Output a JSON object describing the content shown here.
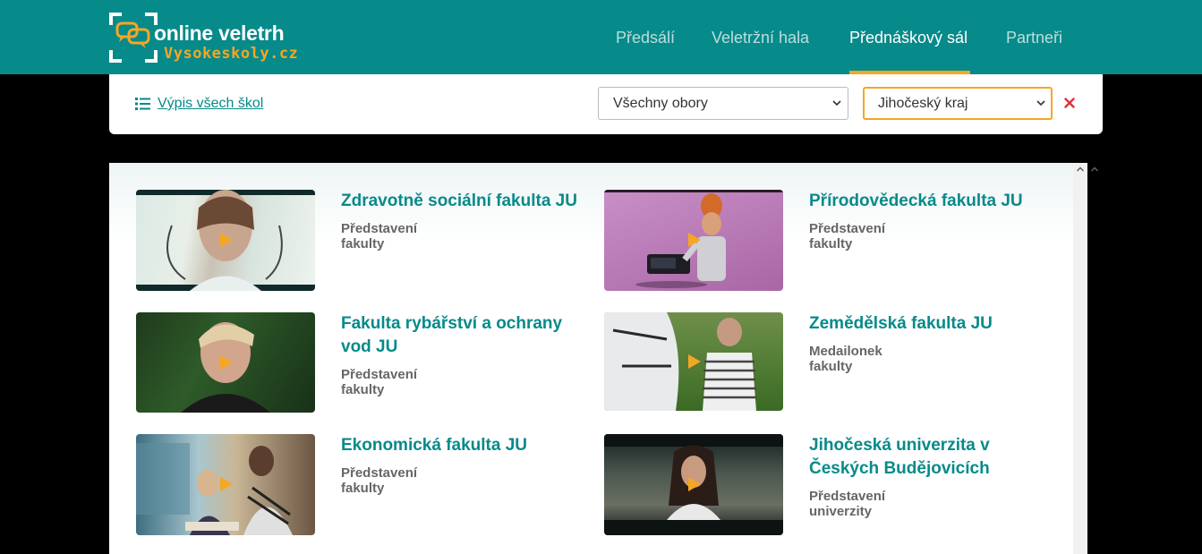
{
  "logo": {
    "line1": "online veletrh",
    "line2": "Vysokeskoly.cz"
  },
  "nav": [
    {
      "label": "Předsálí"
    },
    {
      "label": "Veletržní hala"
    },
    {
      "label": "Přednáškový sál"
    },
    {
      "label": "Partneři"
    }
  ],
  "nav_active": "Přednáškový sál",
  "filters": {
    "list_link": "Výpis všech škol",
    "field_select": "Všechny obory",
    "region_select": "Jihočeský kraj"
  },
  "colors": {
    "brand": "#078a8a",
    "accent": "#f5a623",
    "clear": "#e0303a"
  },
  "cards": [
    {
      "title": "Zdravotně sociální fakulta JU",
      "subtitle": "Představení fakulty",
      "thumb_icon": "stethoscope-portrait"
    },
    {
      "title": "Přírodovědecká fakulta JU",
      "subtitle": "Představení fakulty",
      "thumb_icon": "animated-character"
    },
    {
      "title": "Fakulta rybářství a ochrany vod JU",
      "subtitle": "Představení fakulty",
      "thumb_icon": "smiling-student"
    },
    {
      "title": "Zemědělská fakulta JU",
      "subtitle": "Medailonek fakulty",
      "thumb_icon": "horse-student"
    },
    {
      "title": "Ekonomická fakulta JU",
      "subtitle": "Představení fakulty",
      "thumb_icon": "students-studying"
    },
    {
      "title": "Jihočeská univerzita v Českých Budějovicích",
      "subtitle": "Představení univerzity",
      "thumb_icon": "student-lab"
    }
  ]
}
